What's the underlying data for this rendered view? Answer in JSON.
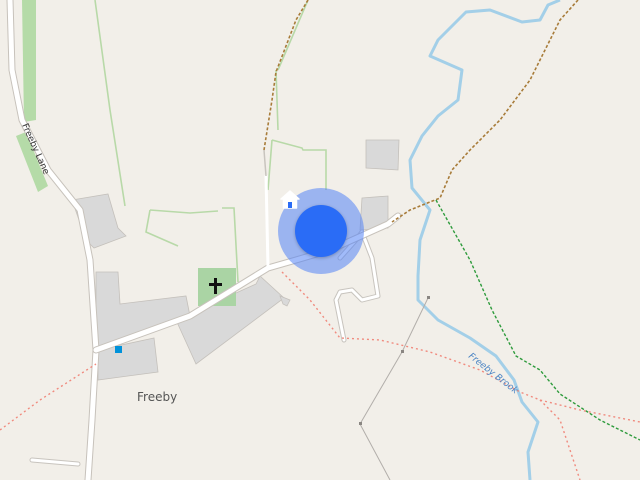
{
  "map": {
    "labels": {
      "road": "Freeby Lane",
      "village": "Freeby",
      "stream": "Freeby Brook"
    },
    "marker": {
      "icon": "home-icon",
      "color": "#2a6cf6"
    },
    "colors": {
      "land": "#f2efe9",
      "building": "#d9d9d9",
      "water": "#a3cfe8",
      "grass": "#addeaa",
      "cemetery": "#aad4a4",
      "footpath": "#f08a7e",
      "bridleway": "#2e9b3c",
      "track": "#a87c3a",
      "road": "#ffffff"
    }
  }
}
